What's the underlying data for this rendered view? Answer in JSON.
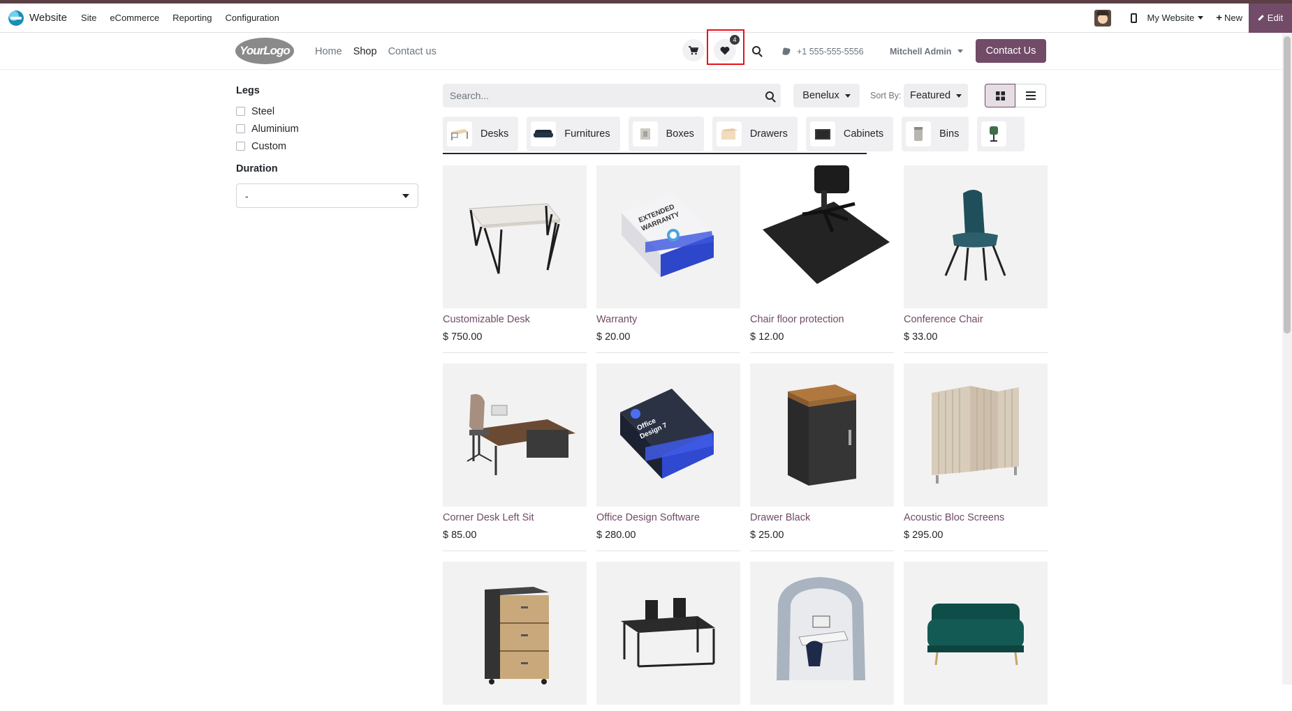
{
  "admin_bar": {
    "app_name": "Website",
    "menu": [
      "Site",
      "eCommerce",
      "Reporting",
      "Configuration"
    ],
    "website_selector": "My Website",
    "new_label": "New",
    "edit_label": "Edit"
  },
  "header": {
    "logo_text": "YourLogo",
    "nav": [
      "Home",
      "Shop",
      "Contact us"
    ],
    "active_nav": "Shop",
    "wishlist_count": "4",
    "phone": "+1 555-555-5556",
    "user": "Mitchell Admin",
    "cta": "Contact Us"
  },
  "filters": {
    "legs_title": "Legs",
    "legs_options": [
      "Steel",
      "Aluminium",
      "Custom"
    ],
    "duration_title": "Duration",
    "duration_value": "-"
  },
  "toolbar": {
    "search_placeholder": "Search...",
    "pricelist": "Benelux",
    "sort_label": "Sort By:",
    "sort_value": "Featured"
  },
  "categories": [
    "Desks",
    "Furnitures",
    "Boxes",
    "Drawers",
    "Cabinets",
    "Bins"
  ],
  "products": [
    {
      "name": "Customizable Desk",
      "price": "$ 750.00"
    },
    {
      "name": "Warranty",
      "price": "$ 20.00"
    },
    {
      "name": "Chair floor protection",
      "price": "$ 12.00"
    },
    {
      "name": "Conference Chair",
      "price": "$ 33.00"
    },
    {
      "name": "Corner Desk Left Sit",
      "price": "$ 85.00"
    },
    {
      "name": "Office Design Software",
      "price": "$ 280.00"
    },
    {
      "name": "Drawer Black",
      "price": "$ 25.00"
    },
    {
      "name": "Acoustic Bloc Screens",
      "price": "$ 295.00"
    },
    {
      "name": "",
      "price": ""
    },
    {
      "name": "",
      "price": ""
    },
    {
      "name": "",
      "price": ""
    },
    {
      "name": "",
      "price": ""
    }
  ],
  "colors": {
    "brand": "#714b67",
    "highlight": "#e8111a"
  }
}
